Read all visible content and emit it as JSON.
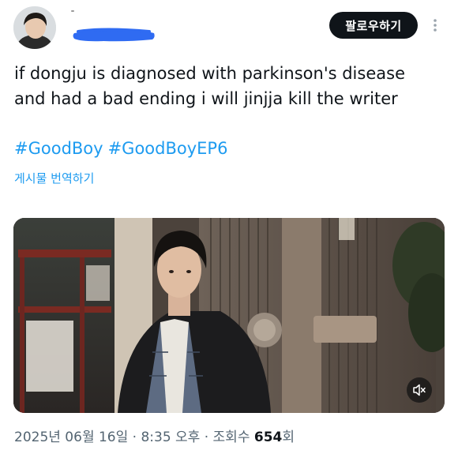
{
  "header": {
    "follow_label": "팔로우하기",
    "avatar_icon": "profile-photo",
    "more_icon": "vertical-ellipsis"
  },
  "tweet": {
    "text_line1": "if dongju is diagnosed with parkinson's disease",
    "text_line2": "and had a bad ending i will jinjja kill the writer",
    "hashtags": [
      "#GoodBoy",
      "#GoodBoyEP6"
    ],
    "translate_label": "게시물 번역하기"
  },
  "media": {
    "mute_icon": "speaker-muted-icon"
  },
  "meta": {
    "timestamp": "2025년 06월 16일 · 8:35 오후 · 조회수 ",
    "views": "654",
    "views_suffix": "회"
  },
  "colors": {
    "accent": "#1d9bf0",
    "text": "#0f1419",
    "secondary": "#536471",
    "redaction": "#2f6bf2"
  }
}
